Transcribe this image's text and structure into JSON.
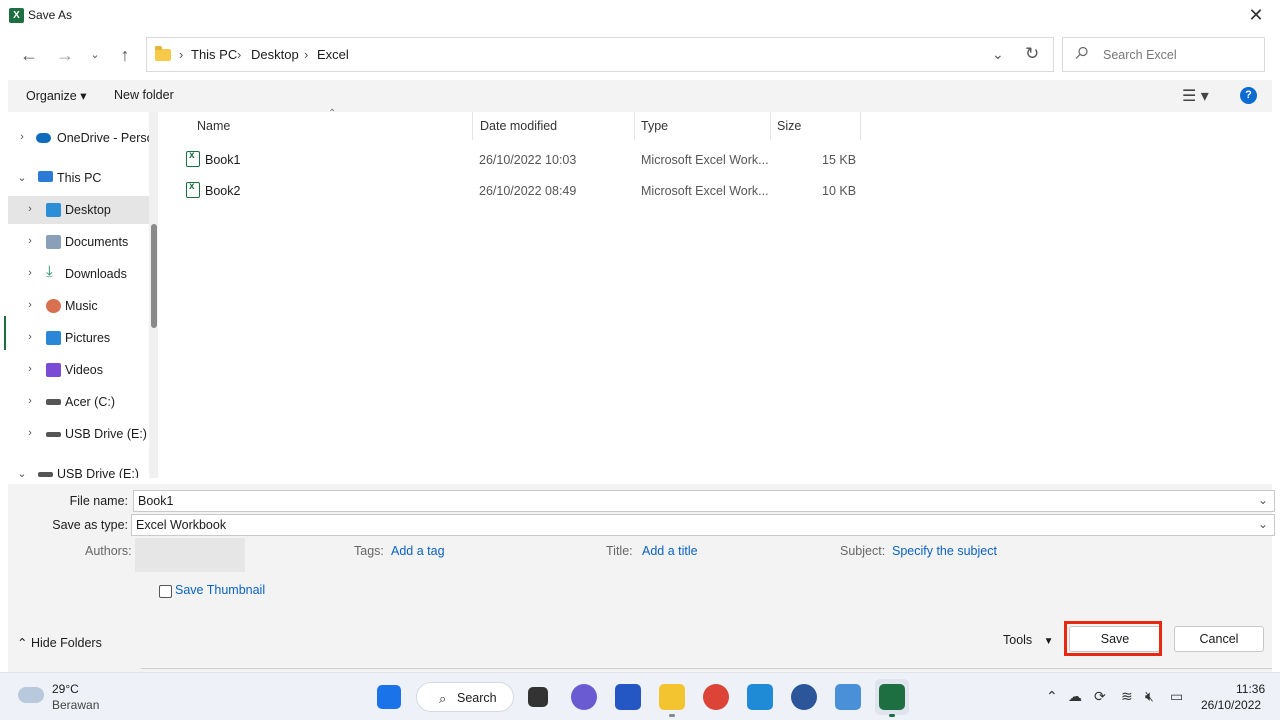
{
  "window": {
    "title": "Save As",
    "app_icon": "excel-icon",
    "close_glyph": "✕"
  },
  "address": {
    "crumbs": [
      "This PC",
      "Desktop",
      "Excel"
    ],
    "separator": "›",
    "search_placeholder": "Search Excel"
  },
  "toolbar": {
    "organize": "Organize ▾",
    "new_folder": "New folder",
    "view_glyph": "☰ ▾",
    "help_glyph": "?"
  },
  "nav": {
    "items": [
      {
        "label": "OneDrive - Perso",
        "icon": "onedrive-icon",
        "color": "#0f6cbd"
      },
      {
        "label": "This PC",
        "icon": "computer-icon",
        "color": "#2b7bd6"
      },
      {
        "label": "Desktop",
        "icon": "desktop-icon",
        "color": "#2b8ed6"
      },
      {
        "label": "Documents",
        "icon": "documents-icon",
        "color": "#8aa0b8"
      },
      {
        "label": "Downloads",
        "icon": "downloads-icon",
        "color": "#1d8f5a"
      },
      {
        "label": "Music",
        "icon": "music-icon",
        "color": "#d9704f"
      },
      {
        "label": "Pictures",
        "icon": "pictures-icon",
        "color": "#2a86d6"
      },
      {
        "label": "Videos",
        "icon": "videos-icon",
        "color": "#7b4bd6"
      },
      {
        "label": "Acer (C:)",
        "icon": "drive-icon",
        "color": "#555555"
      },
      {
        "label": "USB Drive (E:)",
        "icon": "usb-drive-icon",
        "color": "#555555"
      },
      {
        "label": "USB Drive (E:)",
        "icon": "usb-drive-icon",
        "color": "#555555"
      }
    ]
  },
  "files": {
    "headers": {
      "name": "Name",
      "date": "Date modified",
      "type": "Type",
      "size": "Size"
    },
    "rows": [
      {
        "name": "Book1",
        "date": "26/10/2022 10:03",
        "type": "Microsoft Excel Work...",
        "size": "15 KB"
      },
      {
        "name": "Book2",
        "date": "26/10/2022 08:49",
        "type": "Microsoft Excel Work...",
        "size": "10 KB"
      }
    ]
  },
  "form": {
    "file_name_label": "File name:",
    "file_name_value": "Book1",
    "save_type_label": "Save as type:",
    "save_type_value": "Excel Workbook",
    "authors_label": "Authors:",
    "tags_label": "Tags:",
    "tags_link": "Add a tag",
    "title_label": "Title:",
    "title_link": "Add a title",
    "subject_label": "Subject:",
    "subject_link": "Specify the subject",
    "thumbnail_label": "Save Thumbnail"
  },
  "footer": {
    "hide_folders": "Hide Folders",
    "tools": "Tools",
    "save": "Save",
    "cancel": "Cancel"
  },
  "taskbar": {
    "weather_temp": "29°C",
    "weather_desc": "Berawan",
    "search_label": "Search",
    "time": "11:36",
    "date": "26/10/2022",
    "apps": [
      "windows-start-icon",
      "task-view-icon",
      "teams-chat-icon",
      "microsoft-store-icon",
      "file-explorer-icon",
      "chrome-icon",
      "vscode-icon",
      "word-icon",
      "notepad-icon",
      "excel-icon"
    ]
  },
  "colors": {
    "accent": "#0b62c4",
    "excel_green": "#1d6f42",
    "highlight": "#e8280f"
  }
}
